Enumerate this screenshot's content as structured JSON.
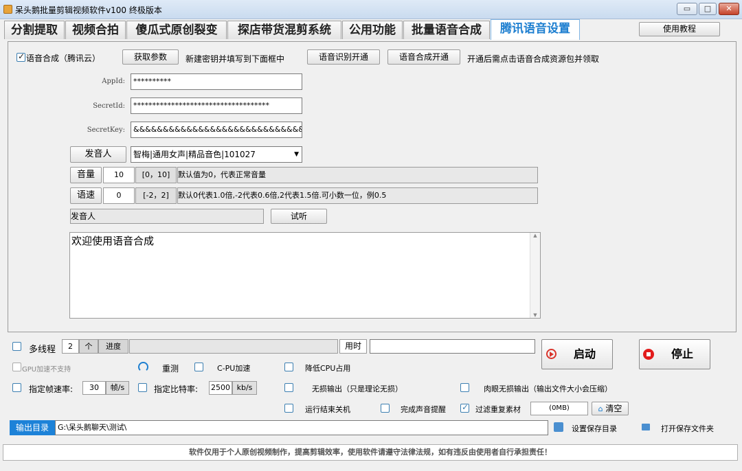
{
  "window": {
    "title": "呆头鹅批量剪辑视频软件v100 终极版本",
    "minimize": "▭",
    "maximize": "□",
    "close": "✕"
  },
  "tabs": [
    {
      "label": "分割提取"
    },
    {
      "label": "视频合拍"
    },
    {
      "label": "傻瓜式原创裂变"
    },
    {
      "label": "探店带货混剪系统"
    },
    {
      "label": "公用功能"
    },
    {
      "label": "批量语音合成"
    },
    {
      "label": "腾讯语音设置"
    }
  ],
  "tutorial_button": "使用教程",
  "tts": {
    "enable_label": "语音合成（腾讯云）",
    "get_params": "获取参数",
    "hint": "新建密钥并填写到下面框中",
    "asr_open": "语音识别开通",
    "tts_open": "语音合成开通",
    "tip": "开通后需点击语音合成资源包并领取",
    "appid_label": "AppId:",
    "appid_value": "**********",
    "secretid_label": "SecretId:",
    "secretid_value": "************************************",
    "secretkey_label": "SecretKey:",
    "secretkey_value": "&&&&&&&&&&&&&&&&&&&&&&&&&&&&&&&&&&",
    "speaker_btn": "发音人",
    "speaker_value": "智梅|通用女声|精品音色|101027",
    "volume_btn": "音量",
    "volume_value": "10",
    "volume_range": "[0，10]",
    "volume_desc": "默认值为0，代表正常音量",
    "speed_btn": "语速",
    "speed_value": "0",
    "speed_range": "[-2，2]",
    "speed_desc": "默认0代表1.0倍,-2代表0.6倍,2代表1.5倍.可小数一位，例0.5",
    "speaker_display": "发音人",
    "listen_btn": "试听",
    "text_area": "欢迎使用语音合成"
  },
  "bottom": {
    "multithread": "多线程",
    "thread_count": "2",
    "unit_ge": "个",
    "progress_label": "进度",
    "progress": 0,
    "elapsed_label": "用时",
    "elapsed_value": "",
    "start": "启动",
    "stop": "停止",
    "gpu": "GPU加速不支持",
    "retest": "重测",
    "cpu_accel": "C-PU加速",
    "lower_cpu": "降低CPU占用",
    "fps_label": "指定帧速率:",
    "fps_value": "30",
    "fps_unit": "帧/s",
    "bitrate_label": "指定比特率:",
    "bitrate_value": "2500",
    "bitrate_unit": "kb/s",
    "lossless": "无损输出（只是理论无损）",
    "visual_lossless": "肉眼无损输出（输出文件大小会压缩）",
    "shutdown": "运行结束关机",
    "sound_alert": "完成声音提醒",
    "filter_dup": "过滤重复素材",
    "size_value": "(0MB)",
    "clear": "清空",
    "output_label": "输出目录",
    "output_path": "G:\\呆头鹅聊天\\测试\\",
    "set_dir": "设置保存目录",
    "open_dir": "打开保存文件夹",
    "footer": "软件仅用于个人原创视频制作，提高剪辑效率，使用软件请遵守法律法规，如有违反由使用者自行承担责任！"
  },
  "colors": {
    "accent": "#1e7fd0",
    "output_label_bg": "#1d82d8",
    "start_icon": "#d9342b",
    "stop_icon": "#e21b1b"
  }
}
